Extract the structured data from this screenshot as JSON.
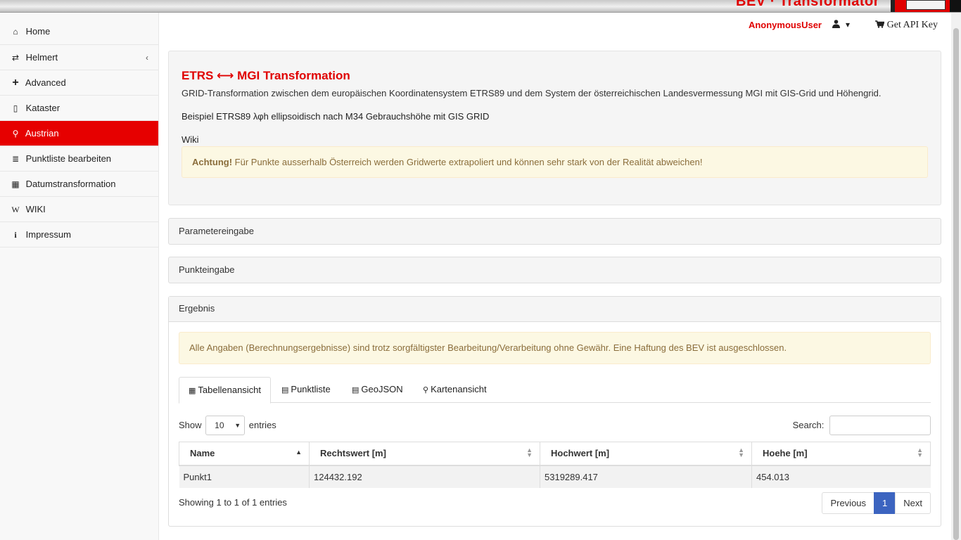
{
  "brand": {
    "title": "BEV · Transformator"
  },
  "sidebar": {
    "items": [
      {
        "label": "Home",
        "icon": "home-icon",
        "glyph": "⌂"
      },
      {
        "label": "Helmert",
        "icon": "exchange-icon",
        "glyph": "⇄",
        "chevron": "‹"
      },
      {
        "label": "Advanced",
        "icon": "plus-icon",
        "glyph": "+"
      },
      {
        "label": "Kataster",
        "icon": "map-icon",
        "glyph": "▯"
      },
      {
        "label": "Austrian",
        "icon": "pin-icon",
        "glyph": "⚲",
        "active": true
      },
      {
        "label": "Punktliste bearbeiten",
        "icon": "list-icon",
        "glyph": "≣"
      },
      {
        "label": "Datumstransformation",
        "icon": "calendar-icon",
        "glyph": "▦"
      },
      {
        "label": "WIKI",
        "icon": "wikipedia-icon",
        "glyph": "W"
      },
      {
        "label": "Impressum",
        "icon": "info-icon",
        "glyph": "i"
      }
    ]
  },
  "userbar": {
    "username": "AnonymousUser",
    "user_caret": "▾",
    "api_key_label": "Get API Key"
  },
  "intro": {
    "title": "ETRS ⟷ MGI Transformation",
    "description": "GRID-Transformation zwischen dem europäischen Koordinatensystem ETRS89 und dem System der österreichischen Landesvermessung MGI mit GIS-Grid und Höhengrid.",
    "example": "Beispiel ETRS89 λφh ellipsoidisch nach M34 Gebrauchshöhe mit GIS GRID",
    "wiki": "Wiki",
    "warning_bold": "Achtung!",
    "warning_text": " Für Punkte ausserhalb Österreich werden Gridwerte extrapoliert und können sehr stark von der Realität abweichen!"
  },
  "accordion": {
    "parameter": "Parametereingabe",
    "punkt": "Punkteingabe",
    "ergebnis": "Ergebnis"
  },
  "result": {
    "disclaimer": "Alle Angaben (Berechnungsergebnisse) sind trotz sorgfältigster Bearbeitung/Verarbeitung ohne Gewähr. Eine Haftung des BEV ist ausgeschlossen.",
    "tabs": [
      {
        "label": "Tabellenansicht",
        "glyph": "▦"
      },
      {
        "label": "Punktliste",
        "glyph": "▤"
      },
      {
        "label": "GeoJSON",
        "glyph": "▤"
      },
      {
        "label": "Kartenansicht",
        "glyph": "⚲"
      }
    ],
    "length": {
      "show": "Show",
      "value": "10",
      "entries": "entries"
    },
    "search_label": "Search:",
    "columns": [
      "Name",
      "Rechtswert [m]",
      "Hochwert [m]",
      "Hoehe [m]"
    ],
    "rows": [
      [
        "Punkt1",
        "124432.192",
        "5319289.417",
        "454.013"
      ]
    ],
    "info": "Showing 1 to 1 of 1 entries",
    "pager": {
      "previous": "Previous",
      "page": "1",
      "next": "Next"
    }
  },
  "colors": {
    "accent": "#e60000",
    "warning_bg": "#fcf8e3",
    "pager_active": "#3c64c0"
  }
}
